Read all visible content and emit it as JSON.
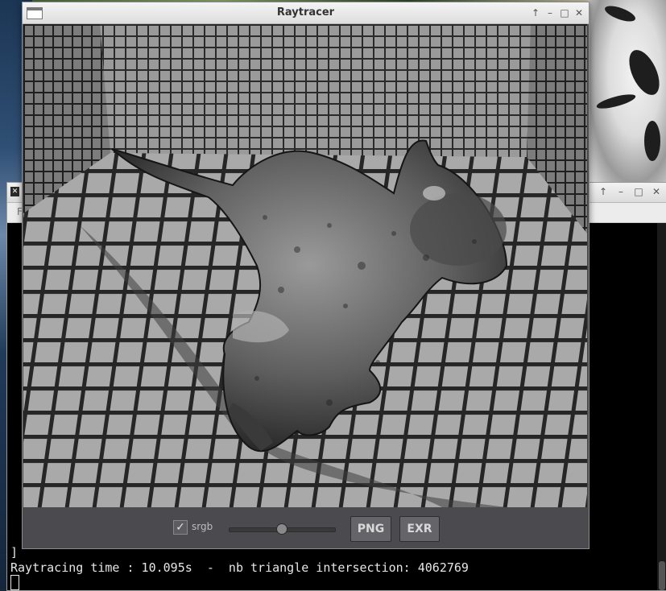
{
  "window": {
    "title": "Raytracer",
    "controls": [
      "maximize-up-icon",
      "minimize-icon",
      "restore-icon",
      "close-icon"
    ]
  },
  "controls": {
    "srgb_label": "srgb",
    "srgb_checked": true,
    "exposure_slider_value": 0.5,
    "png_label": "PNG",
    "exr_label": "EXR"
  },
  "terminal": {
    "menu_partial": "F",
    "line_bracket": "]",
    "line_result": "Raytracing time : 10.095s  -  nb triangle intersection: 4062769"
  },
  "icons": {
    "window_menu": "window-menu-icon",
    "checkbox": "check-icon"
  },
  "colors": {
    "terminal_bg": "#000000",
    "terminal_text": "#e6e6e6",
    "control_bar": "#4b4b4f"
  }
}
